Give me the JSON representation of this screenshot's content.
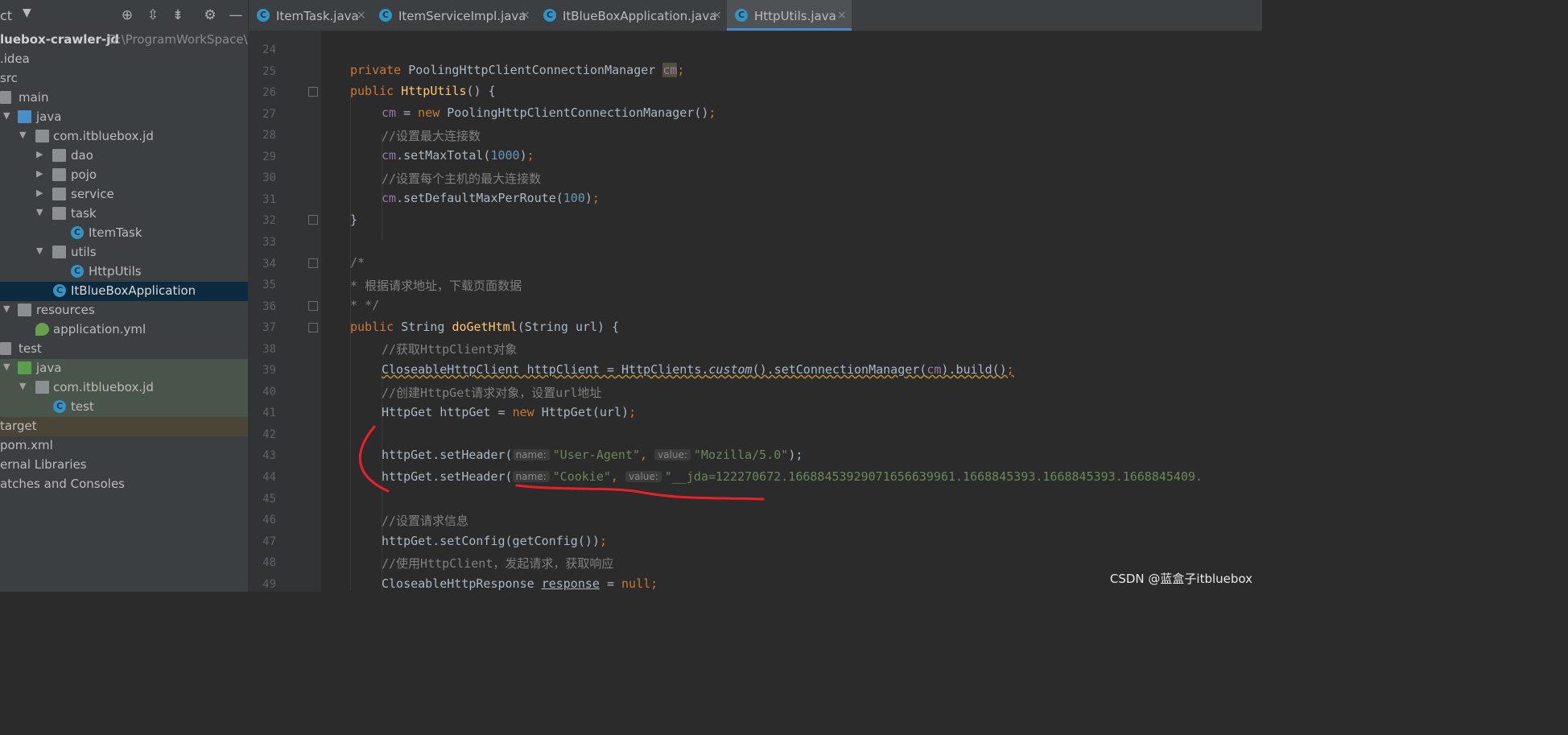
{
  "project": {
    "title": "ct",
    "tree": [
      {
        "label": "luebox-crawler-jd",
        "path": "D:\\ProgramWorkSpace\\ID"
      },
      {
        "label": ".idea"
      },
      {
        "label": "src"
      },
      {
        "label": "main"
      },
      {
        "label": "java"
      },
      {
        "label": "com.itbluebox.jd"
      },
      {
        "label": "dao"
      },
      {
        "label": "pojo"
      },
      {
        "label": "service"
      },
      {
        "label": "task"
      },
      {
        "label": "ItemTask"
      },
      {
        "label": "utils"
      },
      {
        "label": "HttpUtils"
      },
      {
        "label": "ItBlueBoxApplication"
      },
      {
        "label": "resources"
      },
      {
        "label": "application.yml"
      },
      {
        "label": "test"
      },
      {
        "label": "java"
      },
      {
        "label": "com.itbluebox.jd"
      },
      {
        "label": "test"
      },
      {
        "label": "target"
      },
      {
        "label": "pom.xml"
      },
      {
        "label": "ernal Libraries"
      },
      {
        "label": "atches and Consoles"
      }
    ]
  },
  "tabs": [
    {
      "label": "ItemTask.java",
      "close": "×"
    },
    {
      "label": "ItemServiceImpl.java",
      "close": "×"
    },
    {
      "label": "ItBlueBoxApplication.java",
      "close": "×"
    },
    {
      "label": "HttpUtils.java",
      "close": "×"
    }
  ],
  "editor": {
    "line_numbers": [
      "24",
      "25",
      "26",
      "27",
      "28",
      "29",
      "30",
      "31",
      "32",
      "33",
      "34",
      "35",
      "36",
      "37",
      "38",
      "39",
      "40",
      "41",
      "42",
      "43",
      "44",
      "45",
      "46",
      "47",
      "48",
      "49"
    ],
    "code": {
      "l25": {
        "a": "private ",
        "b": "PoolingHttpClientConnectionManager ",
        "c": "cm",
        "d": ";"
      },
      "l26": {
        "a": "public ",
        "b": "HttpUtils",
        "c": "() {"
      },
      "l27": {
        "a": "cm",
        "b": " = ",
        "c": "new ",
        "d": "PoolingHttpClientConnectionManager()",
        "e": ";"
      },
      "l28": "//设置最大连接数",
      "l29": {
        "a": "cm",
        "b": ".setMaxTotal(",
        "c": "1000",
        "d": ")",
        "e": ";"
      },
      "l30": "//设置每个主机的最大连接数",
      "l31": {
        "a": "cm",
        "b": ".setDefaultMaxPerRoute(",
        "c": "100",
        "d": ")",
        "e": ";"
      },
      "l32": "}",
      "l34": "/*",
      "l35": "* 根据请求地址，下载页面数据",
      "l36": "* */",
      "l37": {
        "a": "public ",
        "b": "String ",
        "c": "doGetHtml",
        "d": "(String url) {"
      },
      "l38": "//获取HttpClient对象",
      "l39": {
        "a": "CloseableHttpClient httpClient = HttpClients.",
        "b": "custom",
        "c": "().setConnectionManager(",
        "d": "cm",
        "e": ").build()",
        "f": ";"
      },
      "l40": "//创建HttpGet请求对象，设置url地址",
      "l41": {
        "a": "HttpGet httpGet = ",
        "b": "new ",
        "c": "HttpGet(url)",
        "d": ";"
      },
      "l43": {
        "a": "httpGet.setHeader(",
        "hint1": "name:",
        "s1": "\"User-Agent\"",
        "comma": ", ",
        "hint2": "value:",
        "s2": "\"Mozilla/5.0\"",
        "end": ");"
      },
      "l44": {
        "a": "httpGet.setHeader(",
        "hint1": "name:",
        "s1": "\"Cookie\"",
        "comma": ", ",
        "hint2": "value:",
        "s2": "\"__jda=122270672.16688453929071656639961.1668845393.1668845393.1668845409."
      },
      "l46": "//设置请求信息",
      "l47": {
        "a": "httpGet.setConfig(getConfig())",
        "b": ";"
      },
      "l48": "//使用HttpClient，发起请求，获取响应",
      "l49": {
        "a": "CloseableHttpResponse ",
        "b": "response",
        "c": " = ",
        "d": "null",
        "e": ";"
      }
    }
  },
  "watermark": "CSDN @蓝盒子itbluebox",
  "colors": {
    "keyword": "#cc7832",
    "string": "#6a8759",
    "number": "#6897bb",
    "comment": "#808080",
    "field": "#9876aa",
    "method": "#ffc66d",
    "annotation_stroke": "#e8202a"
  }
}
